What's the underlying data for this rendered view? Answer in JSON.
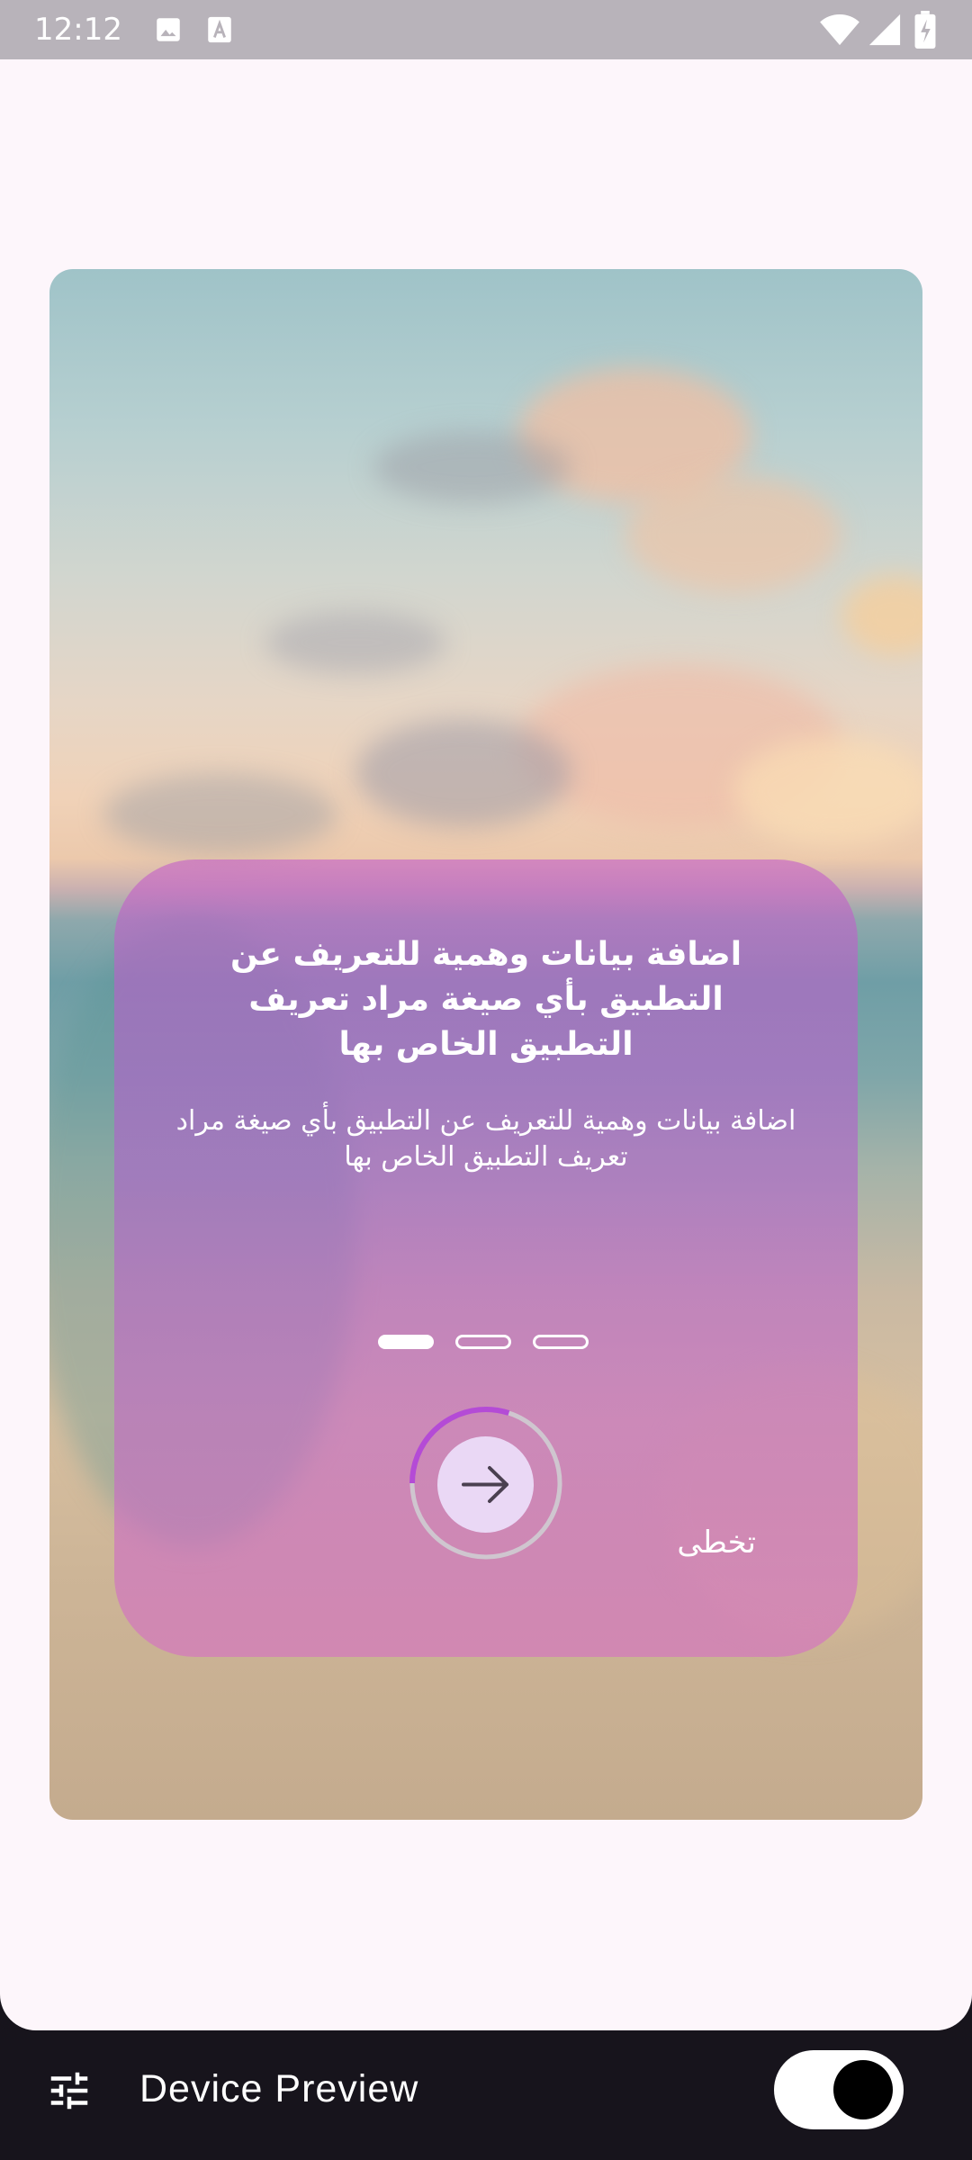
{
  "status_bar": {
    "time": "12:12",
    "icons": [
      "image-icon",
      "font-icon",
      "wifi-icon",
      "signal-icon",
      "battery-charging-icon"
    ]
  },
  "onboarding": {
    "title": "اضافة بيانات وهمية للتعريف عن التطبيق بأي صيغة مراد تعريف التطبيق الخاص بها",
    "description": "اضافة بيانات وهمية للتعريف عن التطبيق بأي صيغة مراد تعريف التطبيق الخاص بها",
    "page_indicator": {
      "total": 3,
      "active": 1
    },
    "progress": 0.3,
    "next_icon": "arrow-right-icon",
    "skip_label": "تخطى",
    "colors": {
      "panel": "#c060c8",
      "button": "#ead8f5",
      "progress": "#b44bd6"
    }
  },
  "device_preview": {
    "icon": "tune-icon",
    "label": "Device Preview",
    "toggle_on": true
  }
}
